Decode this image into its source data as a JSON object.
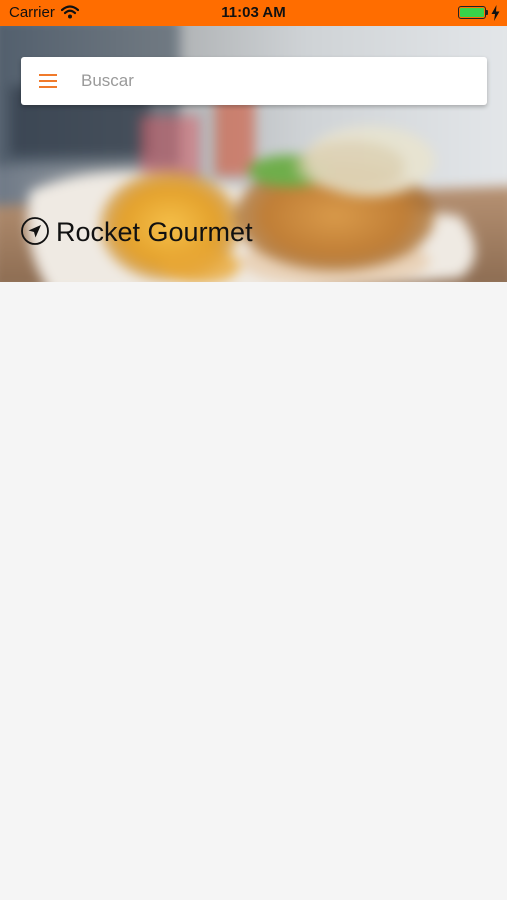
{
  "status_bar": {
    "carrier": "Carrier",
    "time": "11:03 AM",
    "battery_level": 1.0,
    "charging": true,
    "background_color": "#ff6d00"
  },
  "search": {
    "placeholder": "Buscar",
    "value": "",
    "menu_icon": "hamburger-menu-icon"
  },
  "hero": {
    "image": "blurred-food-photo-burger-and-fries",
    "location_icon": "navigation-arrow-icon",
    "restaurant_name": "Rocket Gourmet"
  },
  "colors": {
    "accent": "#f07a2b",
    "status_bar": "#ff6d00",
    "background": "#f5f5f5"
  }
}
